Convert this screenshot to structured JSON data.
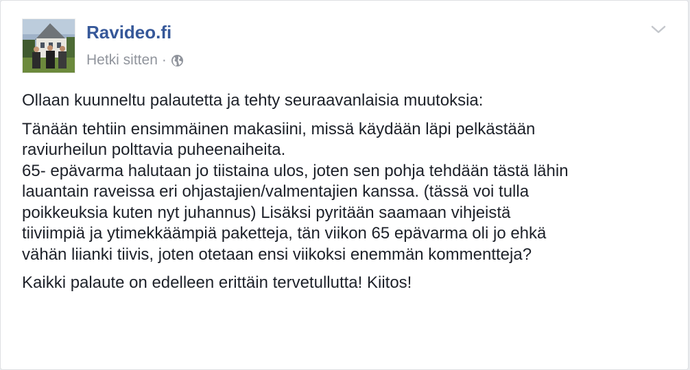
{
  "post": {
    "page_name": "Ravideo.fi",
    "timestamp": "Hetki sitten",
    "separator": "·",
    "privacy_icon": "globe-icon",
    "menu_icon": "chevron-down-icon",
    "avatar_icon": "page-profile-photo",
    "paragraphs": [
      {
        "lines": [
          "Ollaan kuunneltu palautetta ja tehty seuraavanlaisia muutoksia:"
        ]
      },
      {
        "lines": [
          "Tänään tehtiin ensimmäinen makasiini, missä käydään läpi pelkästään",
          "raviurheilun polttavia puheenaiheita.",
          "65- epävarma halutaan jo tiistaina ulos, joten sen pohja tehdään tästä lähin",
          "lauantain raveissa eri ohjastajien/valmentajien kanssa. (tässä voi tulla",
          "poikkeuksia kuten nyt juhannus) Lisäksi pyritään saamaan vihjeistä",
          "tiiviimpiä ja ytimekkäämpiä paketteja, tän viikon 65 epävarma oli jo ehkä",
          "vähän liianki tiivis, joten otetaan ensi viikoksi enemmän kommentteja?"
        ]
      },
      {
        "lines": [
          "Kaikki palaute on edelleen erittäin tervetullutta! Kiitos!"
        ]
      }
    ]
  },
  "colors": {
    "link_blue": "#365899",
    "meta_gray": "#90949c",
    "text": "#1d2129",
    "background": "#e9ebee",
    "card_border": "#dddfe2"
  }
}
